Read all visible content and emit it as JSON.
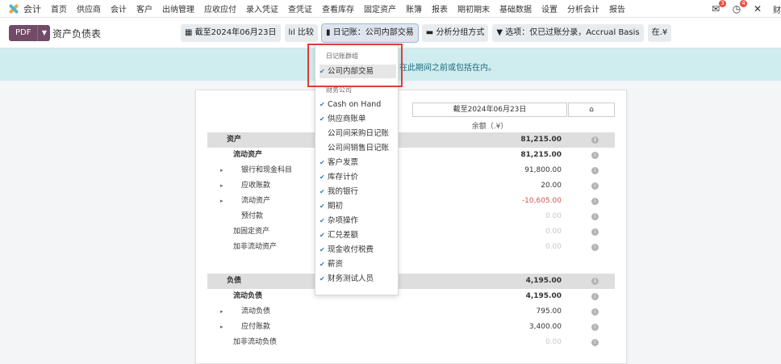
{
  "topnav": {
    "app_name": "会计",
    "menu": [
      "首页",
      "供应商",
      "会计",
      "客户",
      "出纳管理",
      "应收应付",
      "录入凭证",
      "查凭证",
      "查看库存",
      "固定资产",
      "账簿",
      "报表",
      "期初期末",
      "基础数据",
      "设置",
      "分析会计",
      "报告"
    ],
    "messages_badge": "3",
    "activity_badge": "4",
    "user": "财"
  },
  "controlbar": {
    "pdf_label": "PDF",
    "report_title": "资产负债表",
    "filters": [
      {
        "icon": "calendar-icon",
        "label": "▦ 截至2024年06月23日"
      },
      {
        "icon": "chart-icon",
        "label": "lıl 比较"
      },
      {
        "icon": "book-icon",
        "label": "▮ 日记账：公司内部交易"
      },
      {
        "icon": "folder-icon",
        "label": "▬ 分析分组方式"
      },
      {
        "icon": "filter-icon",
        "label": "▼ 选项：仅已过账分录，Accrual Basis"
      },
      {
        "icon": "currency-icon",
        "label": "在.¥"
      }
    ]
  },
  "banner": {
    "text": "在此期间之前或包括在内。"
  },
  "sheet": {
    "column_header": "截至2024年06月23日",
    "column_icon": "⌂",
    "sub_header": "余额（.¥）",
    "rows": [
      {
        "label": "资产",
        "amount": "81,215.00",
        "type": "section",
        "indent": 1
      },
      {
        "label": "流动资产",
        "amount": "81,215.00",
        "type": "bold",
        "indent": 2
      },
      {
        "label": "银行和现金科目",
        "amount": "91,800.00",
        "type": "expand",
        "indent": 3
      },
      {
        "label": "应收账款",
        "amount": "20.00",
        "type": "expand",
        "indent": 3
      },
      {
        "label": "流动资产",
        "amount": "-10,605.00",
        "type": "expand-neg",
        "indent": 3
      },
      {
        "label": "预付款",
        "amount": "0.00",
        "type": "muted",
        "indent": 3
      },
      {
        "label": "加固定资产",
        "amount": "0.00",
        "type": "muted",
        "indent": 2
      },
      {
        "label": "加非流动资产",
        "amount": "0.00",
        "type": "muted",
        "indent": 2
      },
      {
        "label": "负债",
        "amount": "4,195.00",
        "type": "section",
        "indent": 1
      },
      {
        "label": "流动负债",
        "amount": "4,195.00",
        "type": "bold",
        "indent": 2
      },
      {
        "label": "流动负债",
        "amount": "795.00",
        "type": "expand",
        "indent": 3
      },
      {
        "label": "应付账款",
        "amount": "3,400.00",
        "type": "expand",
        "indent": 3
      },
      {
        "label": "加非流动负债",
        "amount": "0.00",
        "type": "muted",
        "indent": 2
      }
    ]
  },
  "dropdown": {
    "group1": "日记账群组",
    "group1_items": [
      {
        "label": "公司内部交易",
        "checked": true
      }
    ],
    "group2": "财务公司",
    "group2_items": [
      {
        "label": "Cash on Hand",
        "checked": true
      },
      {
        "label": "供应商账单",
        "checked": true
      },
      {
        "label": "公司间采购日记账",
        "checked": false
      },
      {
        "label": "公司间销售日记账",
        "checked": false
      },
      {
        "label": "客户发票",
        "checked": true
      },
      {
        "label": "库存计价",
        "checked": true
      },
      {
        "label": "我的银行",
        "checked": true
      },
      {
        "label": "期初",
        "checked": true
      },
      {
        "label": "杂项操作",
        "checked": true
      },
      {
        "label": "汇兑差额",
        "checked": true
      },
      {
        "label": "现金收付税费",
        "checked": true
      },
      {
        "label": "薪资",
        "checked": true
      },
      {
        "label": "财务测试人员",
        "checked": true
      }
    ]
  },
  "colors": {
    "brand": "#714b67",
    "highlight_box": "#e23b3b",
    "banner": "#cfecef",
    "check": "#2e7bbd"
  }
}
